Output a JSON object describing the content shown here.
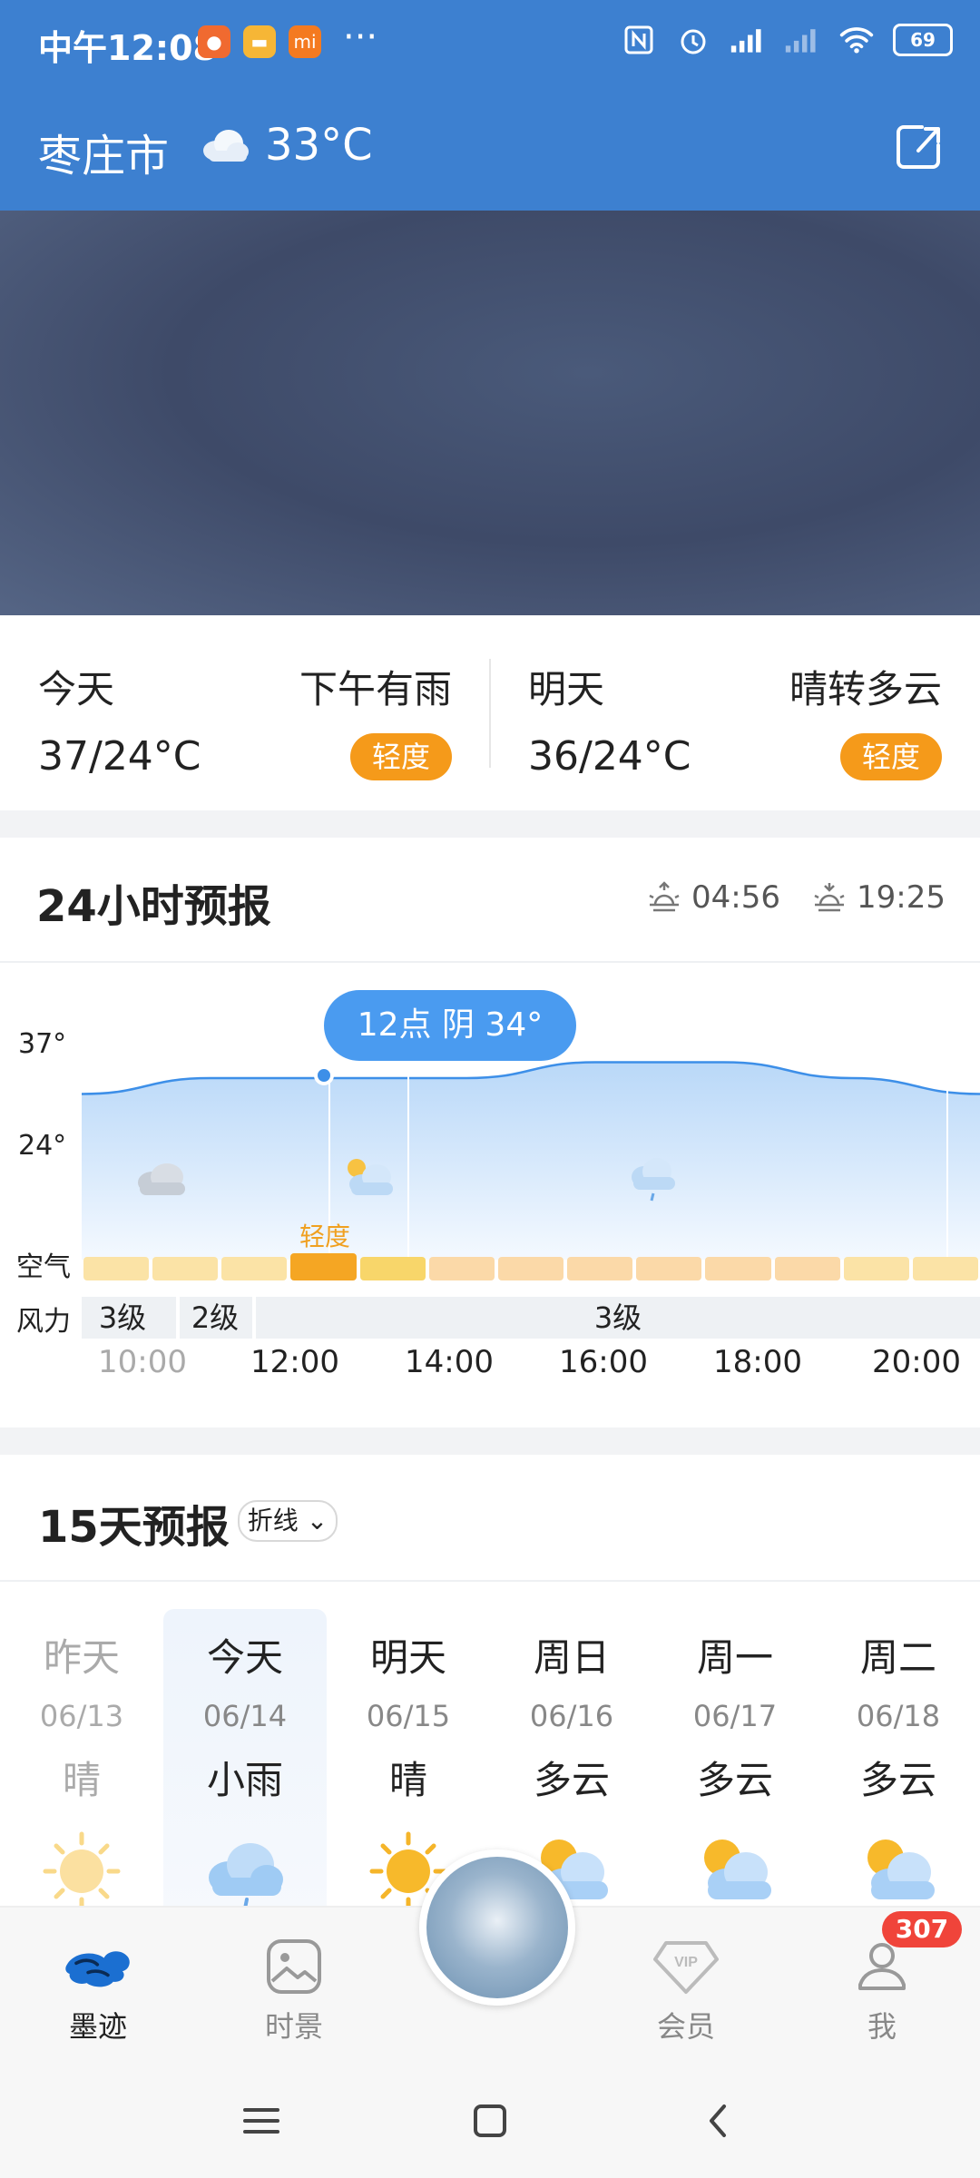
{
  "status": {
    "time": "中午12:08",
    "more": "···",
    "battery": "69"
  },
  "header": {
    "city": "枣庄市",
    "temp": "33°C"
  },
  "days": {
    "today": {
      "label": "今天",
      "cond": "下午有雨",
      "temp": "37/24°C",
      "aqi": "轻度"
    },
    "tomorrow": {
      "label": "明天",
      "cond": "晴转多云",
      "temp": "36/24°C",
      "aqi": "轻度"
    }
  },
  "hourly": {
    "title": "24小时预报",
    "sunrise": "04:56",
    "sunset": "19:25",
    "tooltip": "12点 阴 34°",
    "ymax": "37°",
    "ymin": "24°",
    "air_label": "空气",
    "wind_label": "风力",
    "aqi_text": "轻度",
    "winds": [
      "3级",
      "2级",
      "3级"
    ],
    "times": [
      "10:00",
      "12:00",
      "14:00",
      "16:00",
      "18:00",
      "20:00"
    ],
    "aqi_colors": [
      "#fbe3a6",
      "#fbe3a6",
      "#fbe3a6",
      "#f5a623",
      "#f8d66a",
      "#fbd9a8",
      "#fbd9a8",
      "#fbd9a8",
      "#fbd9a8",
      "#fbd9a8",
      "#fbd9a8",
      "#fbe3a6",
      "#fbe3a6"
    ],
    "temp_values": [
      34,
      35,
      35,
      35,
      36,
      36,
      35,
      34
    ]
  },
  "daily": {
    "title": "15天预报",
    "mode": "折线",
    "items": [
      {
        "name": "昨天",
        "date": "06/13",
        "cond": "晴",
        "icon": "sun-icon"
      },
      {
        "name": "今天",
        "date": "06/14",
        "cond": "小雨",
        "icon": "rain-cloud-icon"
      },
      {
        "name": "明天",
        "date": "06/15",
        "cond": "晴",
        "icon": "sun-icon"
      },
      {
        "name": "周日",
        "date": "06/16",
        "cond": "多云",
        "icon": "partly-cloudy-icon"
      },
      {
        "name": "周一",
        "date": "06/17",
        "cond": "多云",
        "icon": "partly-cloudy-icon"
      },
      {
        "name": "周二",
        "date": "06/18",
        "cond": "多云",
        "icon": "partly-cloudy-icon"
      }
    ]
  },
  "nav": {
    "items": [
      "墨迹",
      "时景",
      "会员",
      "我"
    ],
    "badge": "307"
  }
}
